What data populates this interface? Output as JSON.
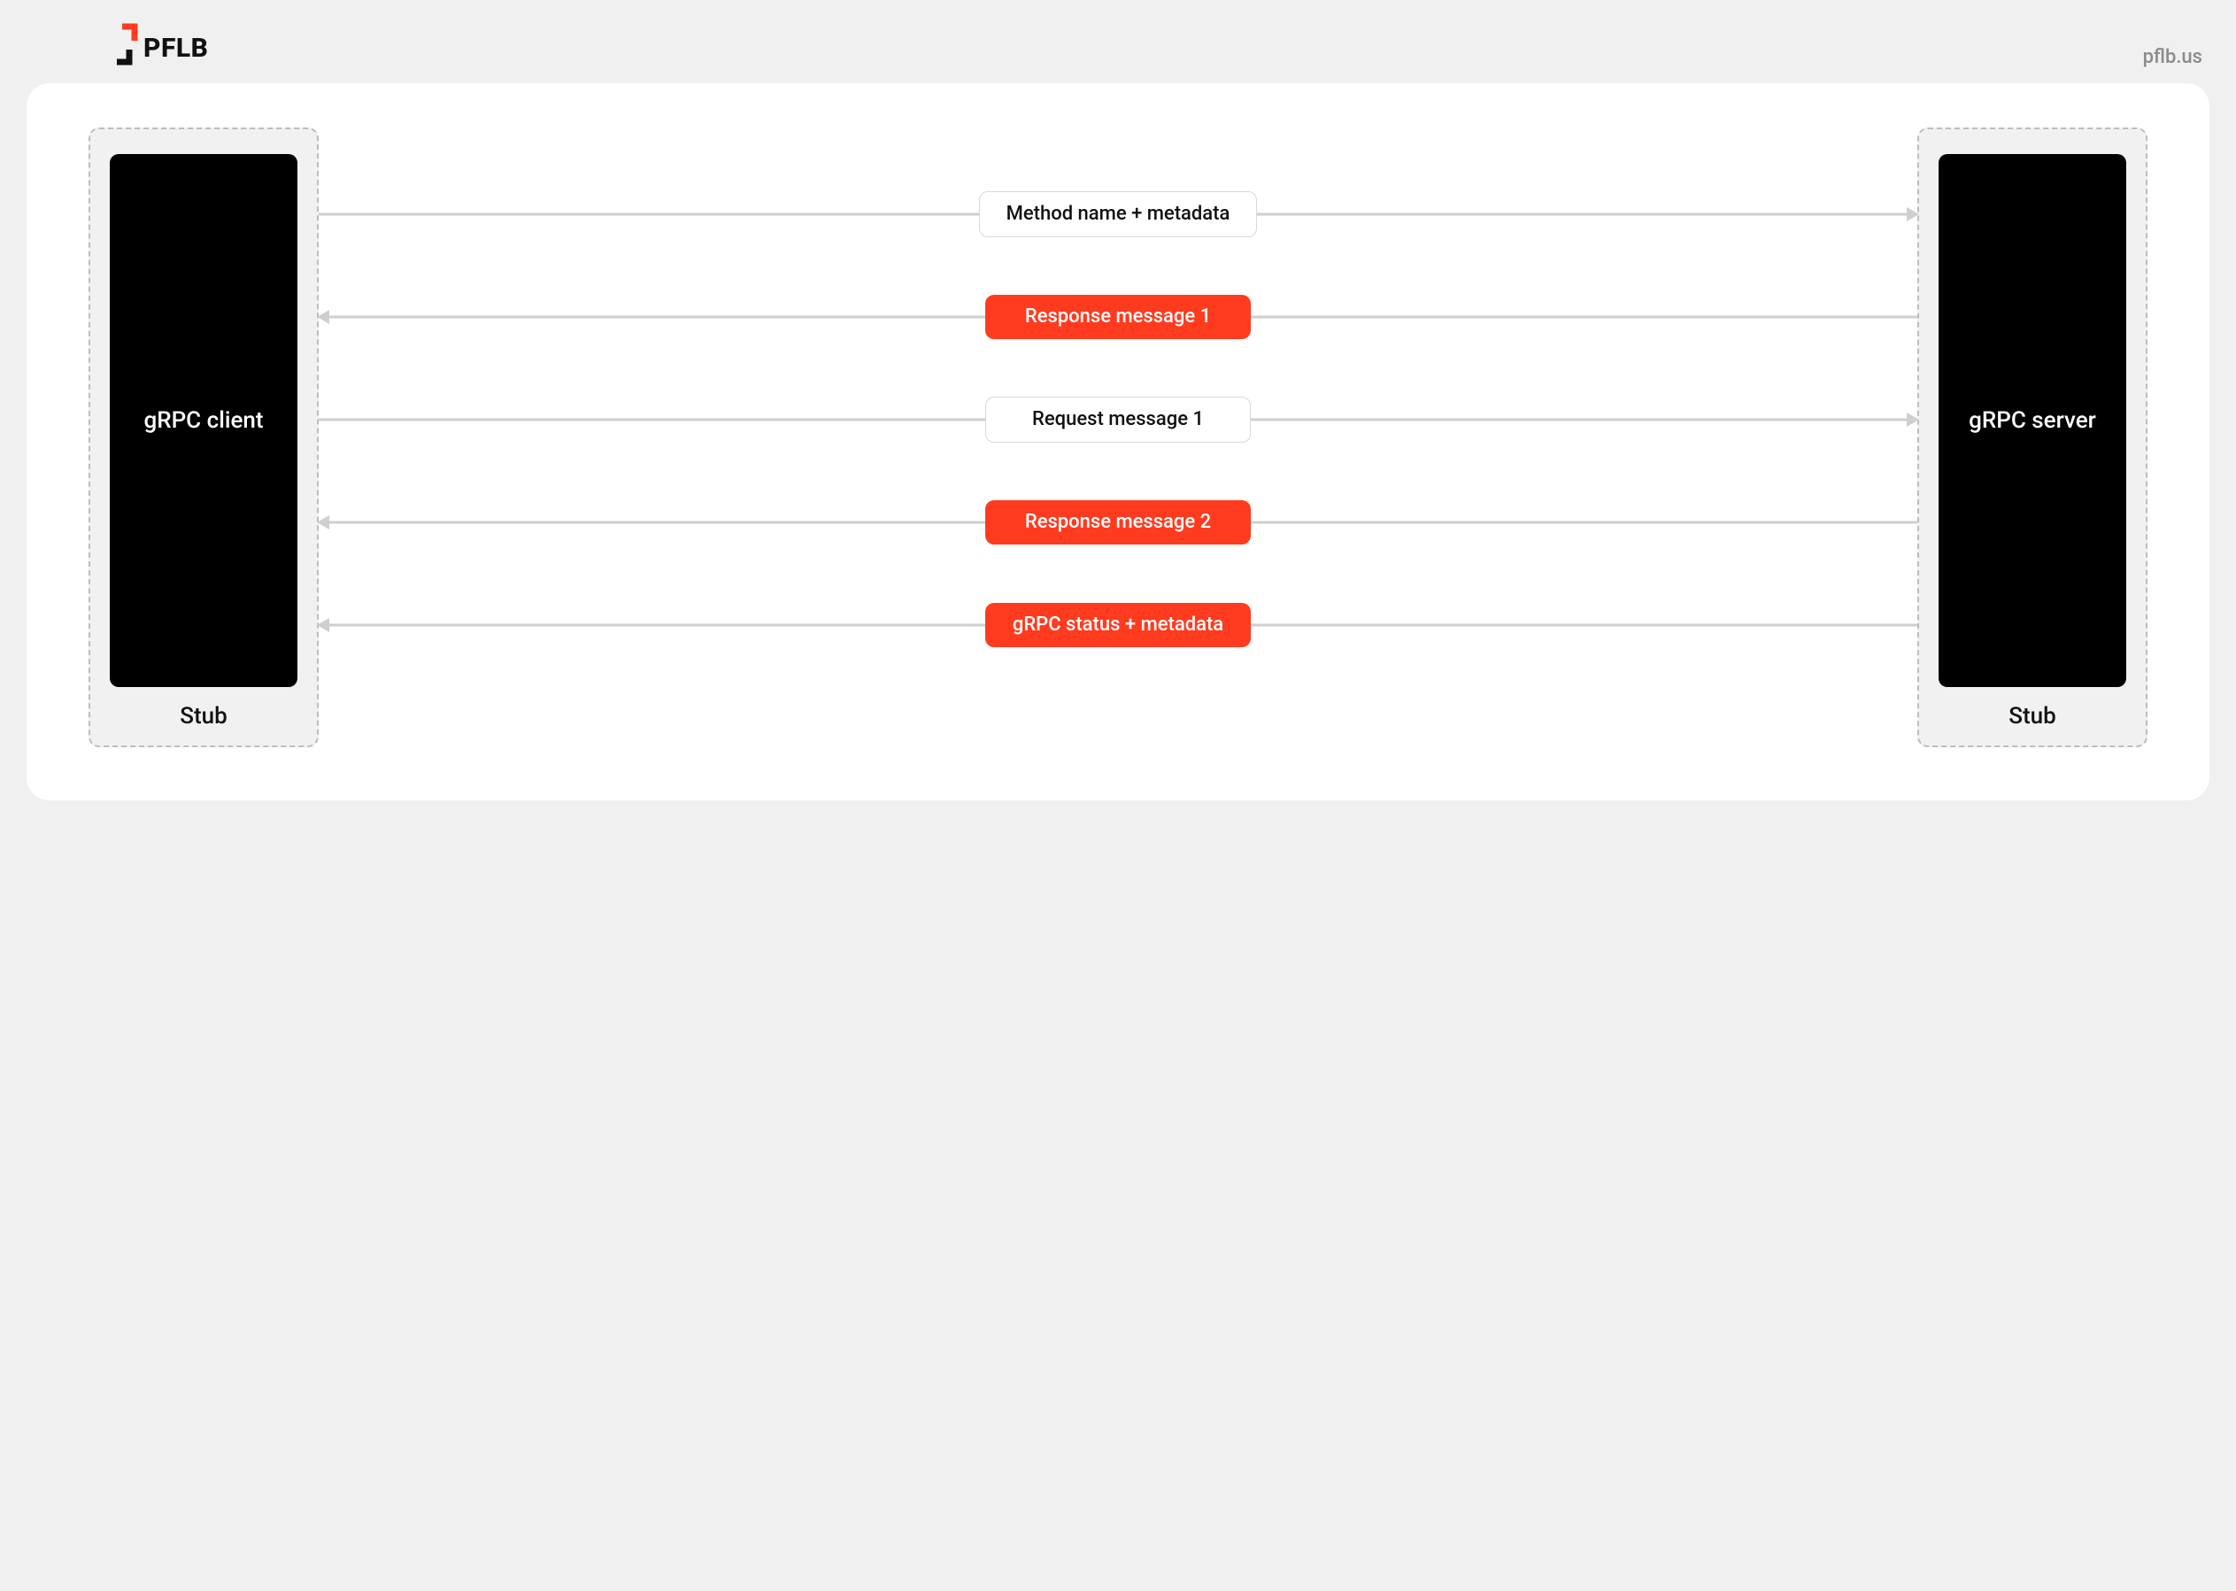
{
  "brand": {
    "name": "PFLB",
    "site": "pflb.us"
  },
  "diagram": {
    "client": {
      "title": "gRPC client",
      "stub_label": "Stub"
    },
    "server": {
      "title": "gRPC server",
      "stub_label": "Stub"
    },
    "flows": [
      {
        "label": "Method name + metadata",
        "direction": "right",
        "style": "white"
      },
      {
        "label": "Response message 1",
        "direction": "left",
        "style": "red"
      },
      {
        "label": "Request message 1",
        "direction": "right",
        "style": "white"
      },
      {
        "label": "Response message 2",
        "direction": "left",
        "style": "red"
      },
      {
        "label": "gRPC status + metadata",
        "direction": "left",
        "style": "red"
      }
    ]
  }
}
